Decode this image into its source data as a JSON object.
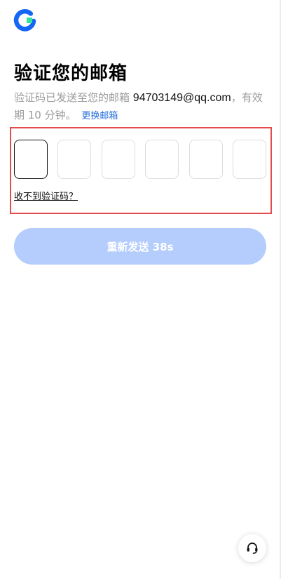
{
  "header": {
    "logo_icon": "okx-style-c-logo",
    "brand_colors": {
      "ring": "#1467F5",
      "accent": "#2EE59B"
    }
  },
  "title": "验证您的邮箱",
  "description": {
    "prefix": "验证码已发送至您的邮箱",
    "email": "94703149@qq.com",
    "suffix": "，有效期 10 分钟。",
    "change_email_link": "更换邮箱"
  },
  "code_input": {
    "length": 6,
    "filled_digits": [
      "",
      "",
      "",
      "",
      "",
      ""
    ],
    "active_index": 0
  },
  "no_code_link": "收不到验证码？",
  "resend_button": {
    "label": "重新发送 38s",
    "enabled": false,
    "color": "#B4CDFD"
  },
  "support_button": {
    "icon": "headset-icon"
  },
  "highlight_color": "#E24C4C"
}
